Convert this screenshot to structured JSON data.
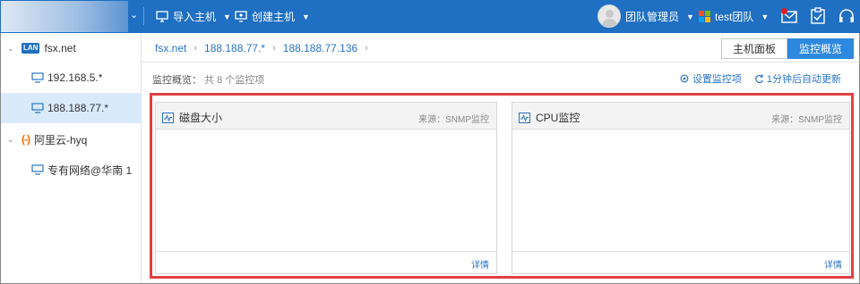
{
  "topbar": {
    "import_host": "导入主机",
    "create_host": "创建主机",
    "team_admin": "团队管理员",
    "team_name": "test团队",
    "icons": [
      "monitor-import-icon",
      "monitor-create-icon",
      "message-icon",
      "task-icon",
      "headset-icon"
    ],
    "colors": {
      "bar": "#1f6fc2",
      "badge": "#e02020"
    }
  },
  "sidebar": {
    "items": [
      {
        "label": "fsx.net",
        "badge": "LAN",
        "expanded": true
      },
      {
        "label": "192.168.5.*"
      },
      {
        "label": "188.188.77.*",
        "active": true
      },
      {
        "label": "阿里云-hyq",
        "badge": "(-)",
        "expanded": true
      },
      {
        "label": "专有网络@华南 1"
      }
    ]
  },
  "breadcrumb": [
    "fsx.net",
    "188.188.77.*",
    "188.188.77.136"
  ],
  "view_tabs": [
    {
      "label": "主机面板",
      "active": false
    },
    {
      "label": "监控概览",
      "active": true
    }
  ],
  "overview": {
    "label": "监控概览：",
    "count_text": "共 8 个监控项",
    "settings_label": "设置监控项",
    "refresh_label": "1分钟后自动更新"
  },
  "panels": [
    {
      "title": "磁盘大小",
      "source": "来源：SNMP监控",
      "detail": "详情"
    },
    {
      "title": "CPU监控",
      "source": "来源：SNMP监控",
      "detail": "详情"
    }
  ],
  "highlight_color": "#e04040"
}
